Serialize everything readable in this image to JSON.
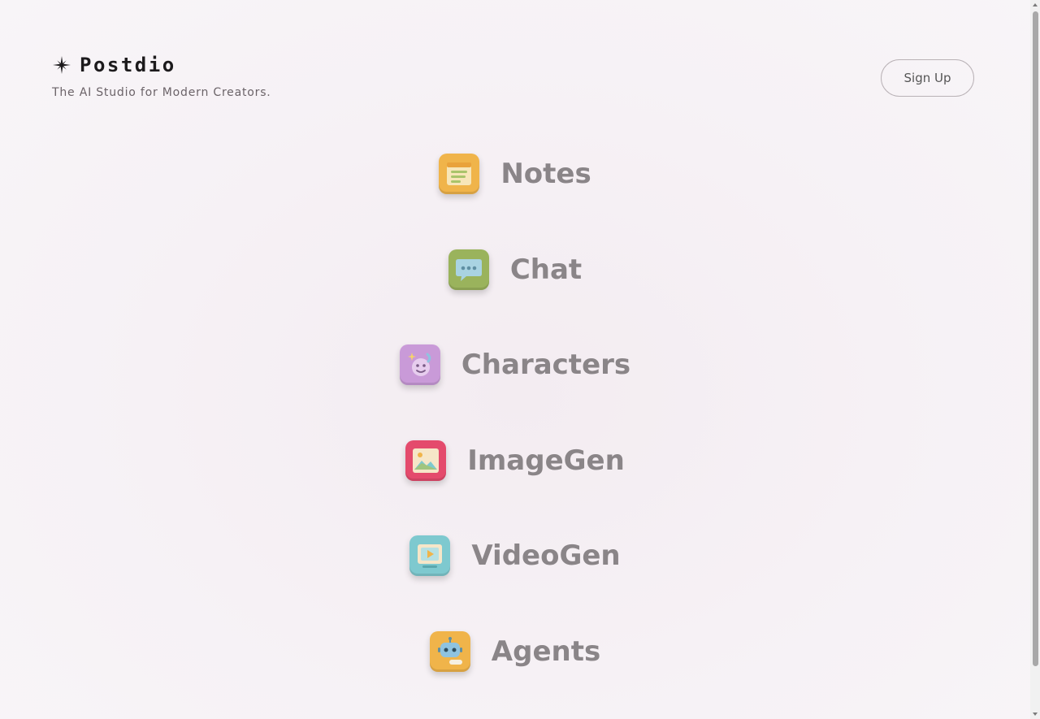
{
  "brand": {
    "title": "Postdio",
    "tagline": "The AI Studio for Modern Creators.",
    "icon": "sparkle-icon"
  },
  "header": {
    "signup_label": "Sign Up"
  },
  "apps": [
    {
      "label": "Notes",
      "icon": "notes-icon",
      "color": "#f0b44a"
    },
    {
      "label": "Chat",
      "icon": "chat-icon",
      "color": "#9ab35c"
    },
    {
      "label": "Characters",
      "icon": "characters-icon",
      "color": "#c99ad8"
    },
    {
      "label": "ImageGen",
      "icon": "image-icon",
      "color": "#e44a6c"
    },
    {
      "label": "VideoGen",
      "icon": "video-icon",
      "color": "#7ec9cf"
    },
    {
      "label": "Agents",
      "icon": "robot-icon",
      "color": "#f0b44a"
    }
  ]
}
